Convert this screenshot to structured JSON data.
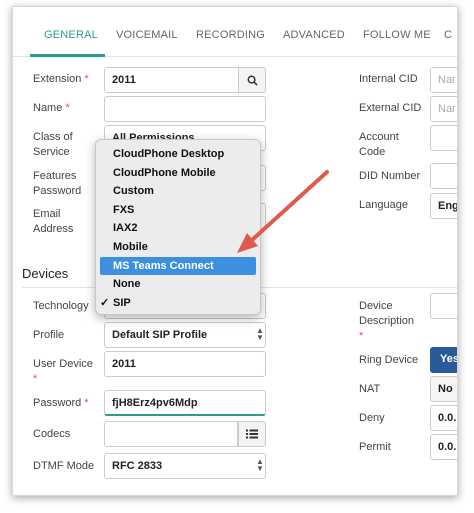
{
  "tabs": [
    "GENERAL",
    "VOICEMAIL",
    "RECORDING",
    "ADVANCED",
    "FOLLOW ME",
    "C"
  ],
  "general": {
    "extension_label": "Extension",
    "extension_value": "2011",
    "name_label": "Name",
    "name_value": "",
    "class_label_1": "Class of",
    "class_label_2": "Service",
    "class_value": "All Permissions",
    "features_label_1": "Features",
    "features_label_2": "Password",
    "email_label_1": "Email",
    "email_label_2": "Address",
    "internal_cid_label": "Internal CID",
    "internal_cid_placeholder": "Nar",
    "external_cid_label": "External CID",
    "external_cid_placeholder": "Nar",
    "account_code_label_1": "Account",
    "account_code_label_2": "Code",
    "did_number_label": "DID Number",
    "language_label": "Language",
    "language_value": "Eng"
  },
  "devices": {
    "title": "Devices",
    "technology_label": "Technology",
    "profile_label": "Profile",
    "profile_value": "Default SIP Profile",
    "user_device_label_1": "User Device",
    "user_device_value": "2011",
    "password_label": "Password",
    "password_value": "fjH8Erz4pv6Mdp",
    "codecs_label": "Codecs",
    "dtmf_label": "DTMF Mode",
    "dtmf_value": "RFC 2833",
    "device_desc_label_1": "Device",
    "device_desc_label_2": "Description",
    "ring_device_label": "Ring Device",
    "ring_device_value": "Yes",
    "nat_label": "NAT",
    "nat_value": "No",
    "deny_label": "Deny",
    "deny_value": "0.0.",
    "permit_label": "Permit",
    "permit_value": "0.0."
  },
  "dropdown": {
    "options": [
      "CloudPhone Desktop",
      "CloudPhone Mobile",
      "Custom",
      "FXS",
      "IAX2",
      "Mobile",
      "MS Teams Connect",
      "None",
      "SIP"
    ],
    "highlighted_index": 6,
    "checked_index": 8,
    "checkmark": "✓"
  },
  "icons": {
    "required": "*",
    "search": "search-icon",
    "list": "list-icon",
    "caret_up": "▲",
    "caret_down": "▼"
  },
  "colors": {
    "accent": "#2a9d8f",
    "highlight": "#3d8fe0",
    "arrow": "#e05a4e",
    "yes_button": "#2b5a9a"
  }
}
